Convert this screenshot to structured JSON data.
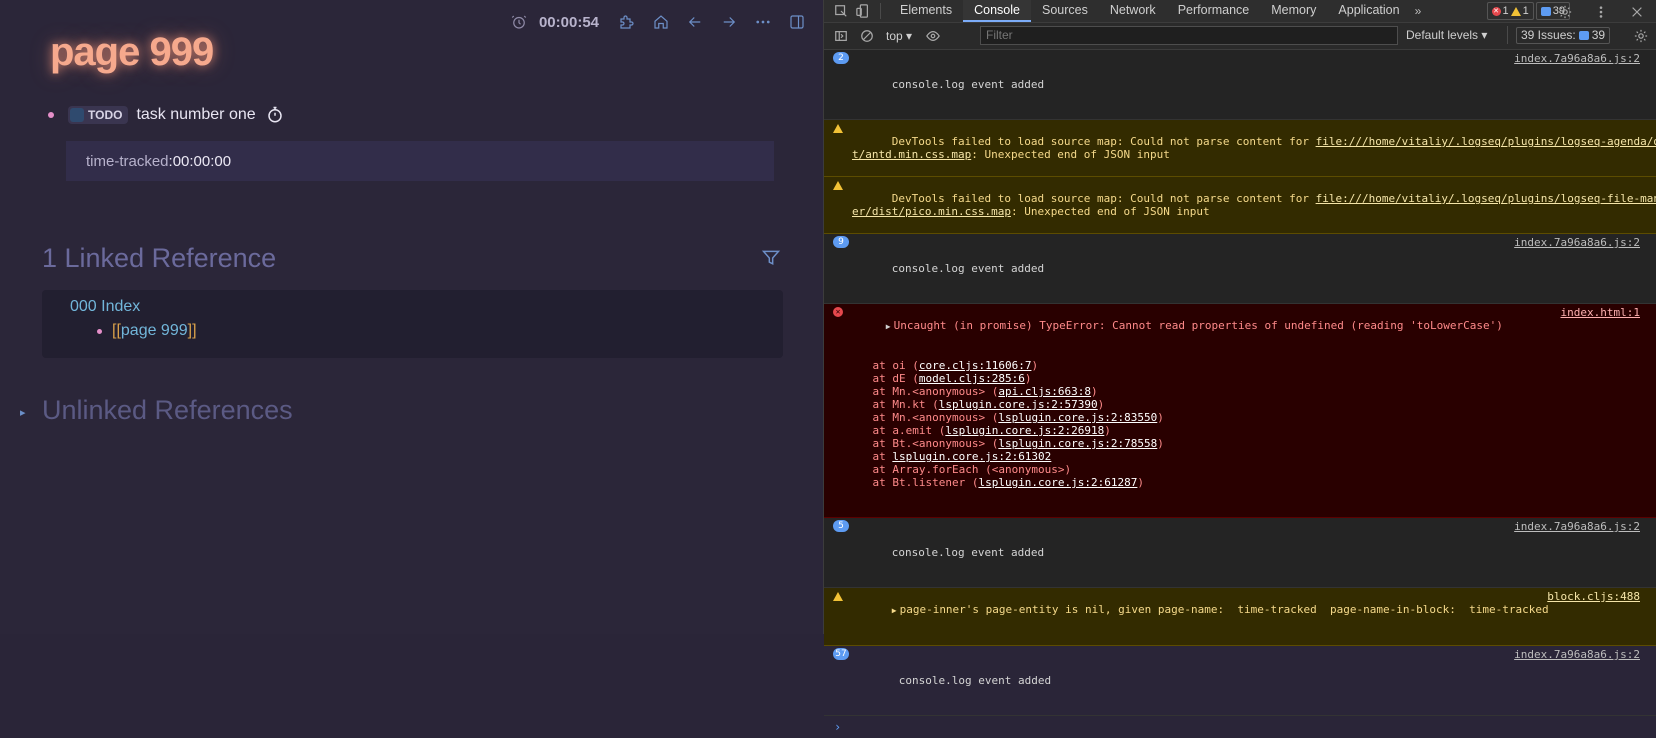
{
  "logseq": {
    "timer": "00:00:54",
    "page_title": "page 999",
    "task": {
      "marker": "TODO",
      "text": "task number one"
    },
    "property": {
      "key": "time-tracked",
      "sep": ": ",
      "value": "00:00:00"
    },
    "linked_title": "1 Linked Reference",
    "ref": {
      "page": "000 Index",
      "open": "[[",
      "link": "page 999",
      "close": "]]"
    },
    "unlinked_title": "Unlinked References",
    "colors": {
      "title": "#f6a98d",
      "link": "#72b6da",
      "bullet": "#e58fc9"
    }
  },
  "devtools": {
    "tabs": [
      "Elements",
      "Console",
      "Sources",
      "Network",
      "Performance",
      "Memory",
      "Application"
    ],
    "active_tab": "Console",
    "error_count": "1",
    "warn_count": "1",
    "msg_count": "39",
    "context": "top",
    "filter_placeholder": "Filter",
    "levels": "Default levels",
    "issues_label": "39 Issues:",
    "issues_count": "39",
    "console": {
      "r1": {
        "count": "2",
        "text": "console.log event added",
        "src": "index.7a96a8a6.js:2"
      },
      "w1": {
        "pre": "DevTools failed to load source map: Could not parse content for ",
        "link": "file:///home/vitaliy/.logseq/plugins/logseq-agenda/dis",
        "link2": "t/antd.min.css.map",
        "post": ": Unexpected end of JSON input"
      },
      "w2": {
        "pre": "DevTools failed to load source map: Could not parse content for ",
        "link": "file:///home/vitaliy/.logseq/plugins/logseq-file-manag",
        "link2": "er/dist/pico.min.css.map",
        "post": ": Unexpected end of JSON input"
      },
      "r2": {
        "count": "9",
        "text": "console.log event added",
        "src": "index.7a96a8a6.js:2"
      },
      "err": {
        "head": "Uncaught (in promise) TypeError: Cannot read properties of undefined (reading 'toLowerCase')",
        "src": "index.html:1",
        "stack": [
          {
            "pre": "    at oi (",
            "link": "core.cljs:11606:7",
            "post": ")"
          },
          {
            "pre": "    at dE (",
            "link": "model.cljs:285:6",
            "post": ")"
          },
          {
            "pre": "    at Mn.<anonymous> (",
            "link": "api.cljs:663:8",
            "post": ")"
          },
          {
            "pre": "    at Mn.kt (",
            "link": "lsplugin.core.js:2:57390",
            "post": ")"
          },
          {
            "pre": "    at Mn.<anonymous> (",
            "link": "lsplugin.core.js:2:83550",
            "post": ")"
          },
          {
            "pre": "    at a.emit (",
            "link": "lsplugin.core.js:2:26918",
            "post": ")"
          },
          {
            "pre": "    at Bt.<anonymous> (",
            "link": "lsplugin.core.js:2:78558",
            "post": ")"
          },
          {
            "pre": "    at ",
            "link": "lsplugin.core.js:2:61302",
            "post": ""
          },
          {
            "pre": "    at Array.forEach (<anonymous>)",
            "link": "",
            "post": ""
          },
          {
            "pre": "    at Bt.listener (",
            "link": "lsplugin.core.js:2:61287",
            "post": ")"
          }
        ]
      },
      "r3": {
        "count": "5",
        "text": "console.log event added",
        "src": "index.7a96a8a6.js:2"
      },
      "w3": {
        "text": "page-inner's page-entity is nil, given page-name:  time-tracked  page-name-in-block:  time-tracked",
        "src": "block.cljs:488"
      },
      "r4": {
        "count": "57",
        "text": "console.log event added",
        "src": "index.7a96a8a6.js:2"
      }
    }
  }
}
